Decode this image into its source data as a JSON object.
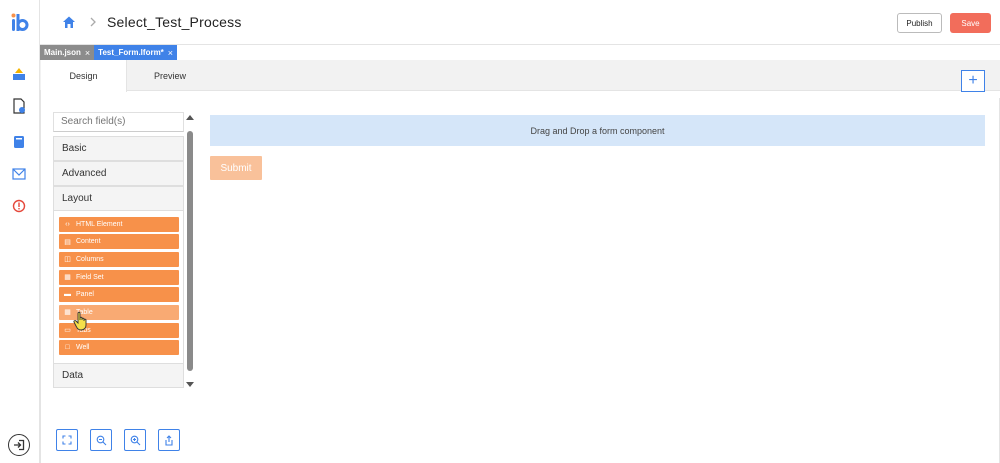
{
  "header": {
    "title": "Select_Test_Process",
    "publish_label": "Publish",
    "save_label": "Save"
  },
  "file_tabs": [
    {
      "label": "Main.json",
      "close": "×",
      "active": false
    },
    {
      "label": "Test_Form.lform*",
      "close": "×",
      "active": true
    }
  ],
  "view_tabs": {
    "design": "Design",
    "preview": "Preview",
    "add": "+"
  },
  "sidebar": {
    "search_placeholder": "Search field(s)",
    "groups": {
      "basic": "Basic",
      "advanced": "Advanced",
      "layout": "Layout",
      "data": "Data"
    },
    "layout_components": [
      {
        "label": "HTML Element",
        "icon": "code-icon"
      },
      {
        "label": "Content",
        "icon": "document-icon"
      },
      {
        "label": "Columns",
        "icon": "columns-icon"
      },
      {
        "label": "Field Set",
        "icon": "fieldset-icon"
      },
      {
        "label": "Panel",
        "icon": "panel-icon"
      },
      {
        "label": "Table",
        "icon": "table-icon"
      },
      {
        "label": "Tabs",
        "icon": "folder-icon"
      },
      {
        "label": "Well",
        "icon": "square-icon"
      }
    ]
  },
  "canvas": {
    "dropzone_text": "Drag and Drop a form component",
    "submit_label": "Submit"
  },
  "colors": {
    "accent": "#3f82e8",
    "save": "#f26d5b",
    "component": "#f7914a",
    "dropzone": "#d5e6f9"
  }
}
